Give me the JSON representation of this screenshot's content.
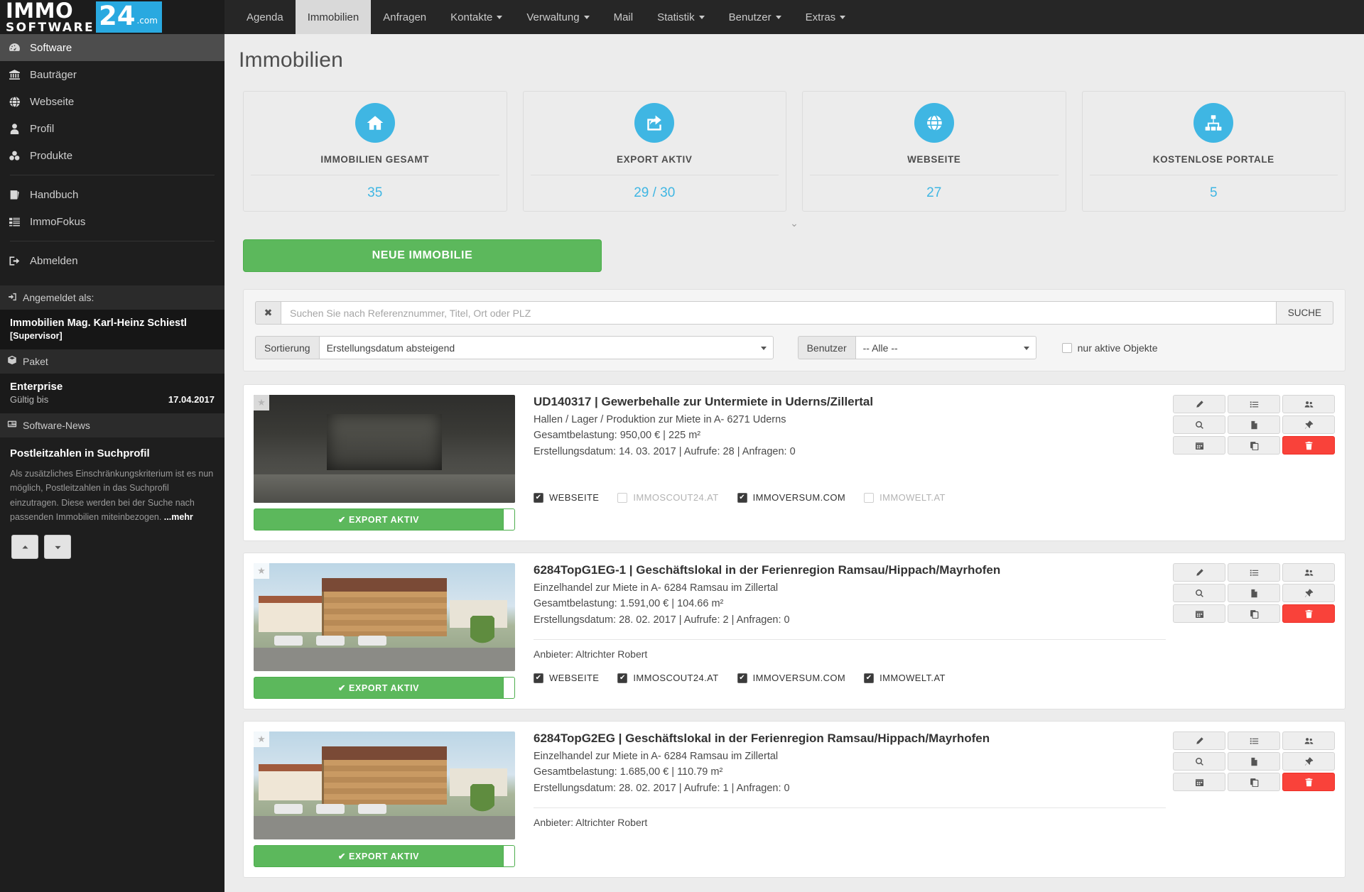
{
  "brand": {
    "immo": "IMMO",
    "software": "SOFTWARE",
    "num": "24",
    "com": ".com"
  },
  "topnav": [
    {
      "label": "Agenda",
      "active": false,
      "caret": false,
      "name": "nav-agenda"
    },
    {
      "label": "Immobilien",
      "active": true,
      "caret": false,
      "name": "nav-immobilien"
    },
    {
      "label": "Anfragen",
      "active": false,
      "caret": false,
      "name": "nav-anfragen"
    },
    {
      "label": "Kontakte",
      "active": false,
      "caret": true,
      "name": "nav-kontakte"
    },
    {
      "label": "Verwaltung",
      "active": false,
      "caret": true,
      "name": "nav-verwaltung"
    },
    {
      "label": "Mail",
      "active": false,
      "caret": false,
      "name": "nav-mail"
    },
    {
      "label": "Statistik",
      "active": false,
      "caret": true,
      "name": "nav-statistik"
    },
    {
      "label": "Benutzer",
      "active": false,
      "caret": true,
      "name": "nav-benutzer"
    },
    {
      "label": "Extras",
      "active": false,
      "caret": true,
      "name": "nav-extras"
    }
  ],
  "sidebar": {
    "items": [
      {
        "label": "Software",
        "icon": "dashboard-icon",
        "active": true
      },
      {
        "label": "Bauträger",
        "icon": "bank-icon",
        "active": false
      },
      {
        "label": "Webseite",
        "icon": "globe-icon",
        "active": false
      },
      {
        "label": "Profil",
        "icon": "user-icon",
        "active": false
      },
      {
        "label": "Produkte",
        "icon": "cubes-icon",
        "active": false
      }
    ],
    "items2": [
      {
        "label": "Handbuch",
        "icon": "book-icon"
      },
      {
        "label": "ImmoFokus",
        "icon": "list-icon"
      }
    ],
    "items3": [
      {
        "label": "Abmelden",
        "icon": "logout-icon"
      }
    ],
    "logged_in_header": "Angemeldet als:",
    "user_name": "Immobilien Mag. Karl-Heinz Schiestl",
    "user_role": "[Supervisor]",
    "paket_header": "Paket",
    "paket_name": "Enterprise",
    "paket_valid_label": "Gültig bis",
    "paket_valid_value": "17.04.2017",
    "news_header": "Software-News",
    "news_title": "Postleitzahlen in Suchprofil",
    "news_body": "Als zusätzliches Einschränkungskriterium ist es nun möglich, Postleitzahlen in das Suchprofil einzutragen. Diese werden bei der Suche nach passenden Immobilien miteinbezogen. ",
    "news_more": "...mehr",
    "news_prev": "▲",
    "news_next": "▼"
  },
  "page": {
    "title": "Immobilien",
    "collapse_arrow": "⌄"
  },
  "stats": [
    {
      "label": "IMMOBILIEN GESAMT",
      "value": "35",
      "icon": "home-icon"
    },
    {
      "label": "EXPORT AKTIV",
      "value": "29 / 30",
      "icon": "export-icon"
    },
    {
      "label": "WEBSEITE",
      "value": "27",
      "icon": "globe-icon"
    },
    {
      "label": "KOSTENLOSE PORTALE",
      "value": "5",
      "icon": "sitemap-icon"
    }
  ],
  "new_button": "NEUE IMMOBILIE",
  "search": {
    "clear_icon": "✖",
    "placeholder": "Suchen Sie nach Referenznummer, Titel, Ort oder PLZ",
    "value": "",
    "button": "SUCHE"
  },
  "filters": {
    "sort_label": "Sortierung",
    "sort_value": "Erstellungsdatum absteigend",
    "user_label": "Benutzer",
    "user_value": "-- Alle --",
    "only_active": "nur aktive Objekte",
    "only_active_checked": false
  },
  "export_label": "EXPORT AKTIV",
  "listings": [
    {
      "thumb": "hall",
      "title": "UD140317 | Gewerbehalle zur Untermiete in Uderns/Zillertal",
      "subtitle": "Hallen / Lager / Produktion zur Miete in A- 6271 Uderns",
      "cost": "Gesamtbelastung: 950,00 € | 225 m²",
      "meta": "Erstellungsdatum: 14. 03. 2017 | Aufrufe: 28 | Anfragen: 0",
      "provider": "",
      "export_active": true,
      "portals": [
        {
          "label": "WEBSEITE",
          "checked": true
        },
        {
          "label": "IMMOSCOUT24.AT",
          "checked": false
        },
        {
          "label": "IMMOVERSUM.COM",
          "checked": true
        },
        {
          "label": "IMMOWELT.AT",
          "checked": false
        }
      ]
    },
    {
      "thumb": "bldg",
      "title": "6284TopG1EG-1 | Geschäftslokal in der Ferienregion Ramsau/Hippach/Mayrhofen",
      "subtitle": "Einzelhandel zur Miete in A- 6284 Ramsau im Zillertal",
      "cost": "Gesamtbelastung: 1.591,00 € | 104.66 m²",
      "meta": "Erstellungsdatum: 28. 02. 2017 | Aufrufe: 2 | Anfragen: 0",
      "provider": "Anbieter:  Altrichter Robert",
      "export_active": true,
      "portals": [
        {
          "label": "WEBSEITE",
          "checked": true
        },
        {
          "label": "IMMOSCOUT24.AT",
          "checked": true
        },
        {
          "label": "IMMOVERSUM.COM",
          "checked": true
        },
        {
          "label": "IMMOWELT.AT",
          "checked": true
        }
      ]
    },
    {
      "thumb": "bldg",
      "title": "6284TopG2EG | Geschäftslokal in der Ferienregion Ramsau/Hippach/Mayrhofen",
      "subtitle": "Einzelhandel zur Miete in A- 6284 Ramsau im Zillertal",
      "cost": "Gesamtbelastung: 1.685,00 € | 110.79 m²",
      "meta": "Erstellungsdatum: 28. 02. 2017 | Aufrufe: 1 | Anfragen: 0",
      "provider": "Anbieter:  Altrichter Robert",
      "export_active": true,
      "portals": []
    }
  ],
  "row_actions": [
    [
      "edit-icon",
      "list-icon",
      "users-icon"
    ],
    [
      "search-icon",
      "pdf-icon",
      "pin-icon"
    ],
    [
      "calendar-icon",
      "copy-icon",
      "trash-icon"
    ]
  ],
  "colors": {
    "accent": "#3fb6e3",
    "green": "#5cb85c",
    "red": "#f9423a",
    "dark": "#1e1e1e"
  }
}
